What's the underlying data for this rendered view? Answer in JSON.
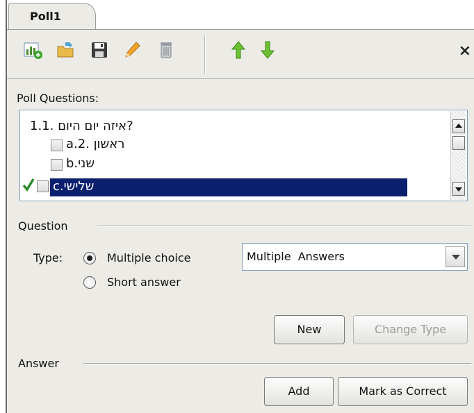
{
  "tabs": [
    {
      "label": "Poll1"
    }
  ],
  "toolbar": {
    "icons": [
      "new-poll-icon",
      "open-folder-icon",
      "save-icon",
      "edit-pencil-icon",
      "trash-icon",
      "move-up-icon",
      "move-down-icon"
    ],
    "close_label": "×"
  },
  "poll_questions": {
    "label": "Poll Questions:",
    "items": [
      {
        "text": "1.1. איזה יום היום?"
      },
      {
        "text": "a.2. ראשון"
      },
      {
        "text": "b.שני"
      },
      {
        "text": "c.שלישי",
        "selected": true,
        "correct": true
      }
    ]
  },
  "question": {
    "section_label": "Question",
    "type_label": "Type:",
    "options": [
      {
        "label": "Multiple choice",
        "checked": true
      },
      {
        "label": "Short answer",
        "checked": false
      }
    ],
    "mode_select": "Multiple  Answers",
    "new_button": "New",
    "change_type_button": "Change Type"
  },
  "answer": {
    "section_label": "Answer",
    "add_button": "Add",
    "mark_correct_button": "Mark as Correct"
  },
  "colors": {
    "selection": "#0a1f6e",
    "check": "#2d8a2a",
    "arrows": "#5fb02e"
  }
}
